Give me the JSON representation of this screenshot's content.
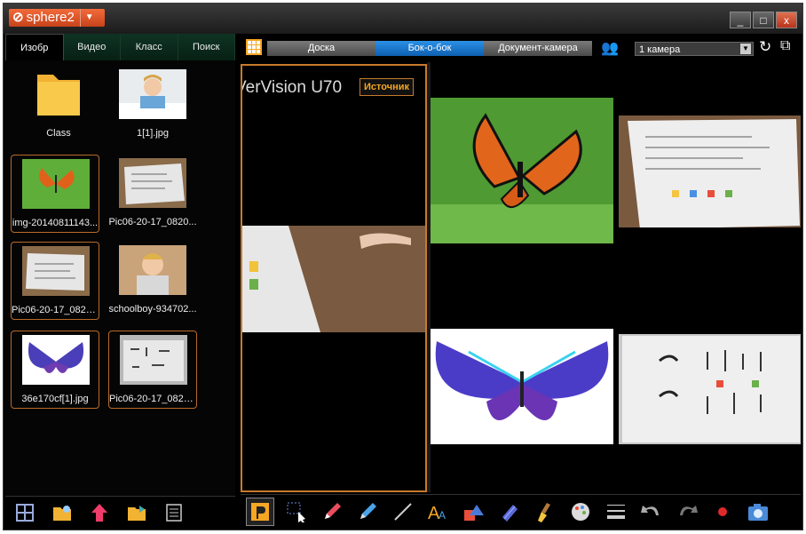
{
  "app": {
    "title": "sphere2"
  },
  "window": {
    "minimize": "_",
    "maximize": "□",
    "close": "x"
  },
  "tabs": [
    {
      "label": "Изобр"
    },
    {
      "label": "Видео"
    },
    {
      "label": "Класс"
    },
    {
      "label": "Поиск"
    }
  ],
  "files": [
    {
      "name": "Class",
      "kind": "folder"
    },
    {
      "name": "1[1].jpg",
      "kind": "photo-boy"
    },
    {
      "name": "img-20140811143...",
      "kind": "photo-butterfly"
    },
    {
      "name": "Pic06-20-17_0820...",
      "kind": "photo-paper"
    },
    {
      "name": "Pic06-20-17_0820...",
      "kind": "photo-paper"
    },
    {
      "name": "schoolboy-934702...",
      "kind": "photo-boy"
    },
    {
      "name": "36e170cf[1].jpg",
      "kind": "photo-bluebutterfly"
    },
    {
      "name": "Pic06-20-17_0825...",
      "kind": "photo-paper"
    }
  ],
  "modes": [
    {
      "label": "Доска"
    },
    {
      "label": "Бок-о-бок"
    },
    {
      "label": "Документ-камера"
    }
  ],
  "camera": {
    "selected": "1 камера"
  },
  "viewer": {
    "source_title": "VerVision U70",
    "source_button": "Источник"
  },
  "icons": {
    "left_toolbar": [
      "split-view-icon",
      "open-folder-icon",
      "upload-icon",
      "folder-export-icon",
      "list-icon"
    ],
    "bottom_toolbar": [
      "source-icon",
      "select-rect-icon",
      "pen-icon",
      "highlighter-icon",
      "line-icon",
      "text-icon",
      "shapes-icon",
      "marker-icon",
      "eraser-icon",
      "color-icon",
      "line-width-icon",
      "undo-icon",
      "redo-icon",
      "record-icon",
      "camera-icon"
    ]
  },
  "colors": {
    "accent": "#c77a2b",
    "active_mode": "#1f7fd6",
    "brand": "#e4572e"
  }
}
